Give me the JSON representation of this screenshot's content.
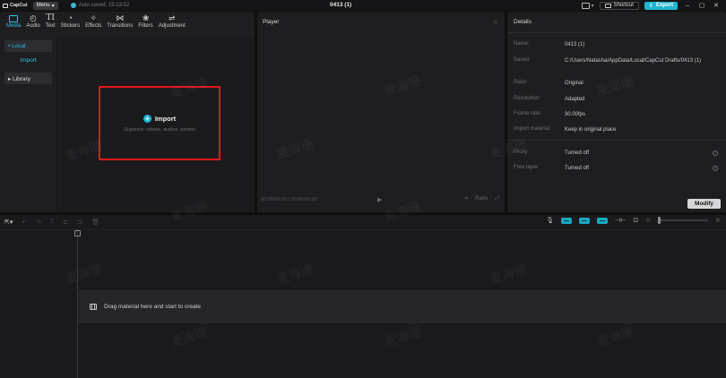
{
  "titlebar": {
    "app_name": "CapCut",
    "menu_label": "Menu",
    "autosave_text": "Auto saved: 15:13:52",
    "project_title": "0413 (1)",
    "shortcut_label": "Shortcut",
    "export_label": "Export"
  },
  "toolbar": {
    "tabs": [
      {
        "label": "Media",
        "icon": "media-icon",
        "active": true
      },
      {
        "label": "Audio",
        "icon": "audio-icon"
      },
      {
        "label": "Text",
        "icon": "text-icon"
      },
      {
        "label": "Stickers",
        "icon": "stickers-icon"
      },
      {
        "label": "Effects",
        "icon": "effects-icon"
      },
      {
        "label": "Transitions",
        "icon": "transitions-icon"
      },
      {
        "label": "Filters",
        "icon": "filters-icon"
      },
      {
        "label": "Adjustment",
        "icon": "adjustment-icon"
      }
    ]
  },
  "sidebar": {
    "local": "• Local",
    "import": "Import",
    "library": "▸ Library"
  },
  "media": {
    "import_label": "Import",
    "import_hint": "Supports: videos, audios, photos"
  },
  "player": {
    "title": "Player",
    "timecode": "00:00:00:00 / 00:00:00:00",
    "ratio_label": "Ratio"
  },
  "details": {
    "title": "Details",
    "rows": [
      {
        "label": "Name:",
        "value": "0413 (1)"
      },
      {
        "label": "Saved:",
        "value": "C:/Users/Natasha/AppData/Local/CapCut Drafts/0413 (1)"
      },
      {
        "label": "Ratio:",
        "value": "Original"
      },
      {
        "label": "Resolution:",
        "value": "Adapted"
      },
      {
        "label": "Frame rate:",
        "value": "30.00fps"
      },
      {
        "label": "Import material:",
        "value": "Keep in original place"
      }
    ],
    "proxy": {
      "label": "Proxy:",
      "value": "Turned off"
    },
    "free_layer": {
      "label": "Free layer:",
      "value": "Turned off"
    },
    "modify_label": "Modify"
  },
  "timeline": {
    "drag_hint": "Drag material here and start to create"
  },
  "watermark_text": "麦海珊",
  "colors": {
    "accent": "#1fb5cf",
    "highlight_border": "#e0171b",
    "panel_bg": "#1e1e20"
  }
}
